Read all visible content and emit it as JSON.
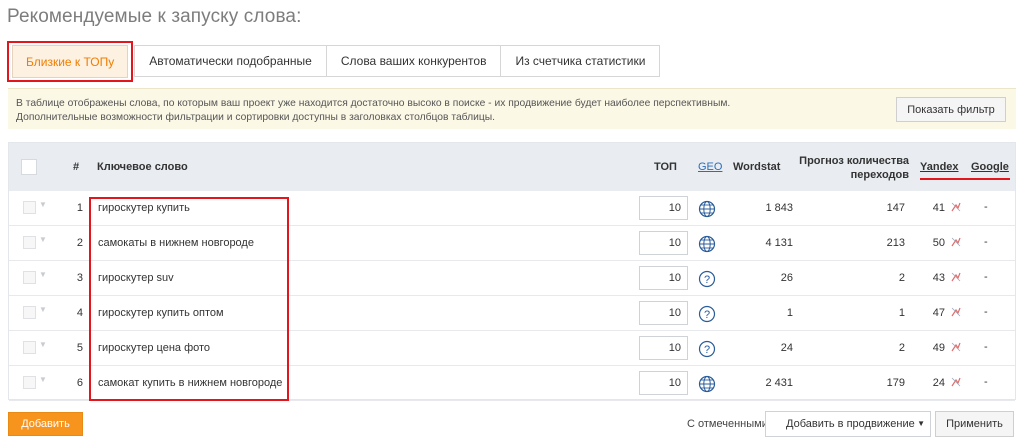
{
  "page": {
    "title": "Рекомендуемые к запуску слова:"
  },
  "tabs": [
    {
      "label": "Близкие к ТОПу",
      "active": true
    },
    {
      "label": "Автоматически подобранные",
      "active": false
    },
    {
      "label": "Слова ваших конкурентов",
      "active": false
    },
    {
      "label": "Из счетчика статистики",
      "active": false
    }
  ],
  "info": {
    "line1": "В таблице отображены слова, по которым ваш проект уже находится достаточно высоко в поиске - их продвижение будет наиболее перспективным.",
    "line2": "Дополнительные возможности фильтрации и сортировки доступны в заголовках столбцов таблицы.",
    "filter_button": "Показать фильтр"
  },
  "table": {
    "headers": {
      "num": "#",
      "keyword": "Ключевое слово",
      "top": "ТОП",
      "geo": "GEO",
      "wordstat": "Wordstat",
      "forecast_line1": "Прогноз количества",
      "forecast_line2": "переходов",
      "yandex": "Yandex",
      "google": "Google"
    },
    "rows": [
      {
        "num": "1",
        "keyword": "гироскутер купить",
        "top": "10",
        "geo": "globe-icon",
        "wordstat": "1 843",
        "forecast": "147",
        "yandex": "41",
        "google": "-"
      },
      {
        "num": "2",
        "keyword": "самокаты в нижнем новгороде",
        "top": "10",
        "geo": "globe-icon",
        "wordstat": "4 131",
        "forecast": "213",
        "yandex": "50",
        "google": "-"
      },
      {
        "num": "3",
        "keyword": "гироскутер suv",
        "top": "10",
        "geo": "question-icon",
        "wordstat": "26",
        "forecast": "2",
        "yandex": "43",
        "google": "-"
      },
      {
        "num": "4",
        "keyword": "гироскутер купить оптом",
        "top": "10",
        "geo": "question-icon",
        "wordstat": "1",
        "forecast": "1",
        "yandex": "47",
        "google": "-"
      },
      {
        "num": "5",
        "keyword": "гироскутер цена фото",
        "top": "10",
        "geo": "question-icon",
        "wordstat": "24",
        "forecast": "2",
        "yandex": "49",
        "google": "-"
      },
      {
        "num": "6",
        "keyword": "самокат купить в нижнем новгороде",
        "top": "10",
        "geo": "globe-icon",
        "wordstat": "2 431",
        "forecast": "179",
        "yandex": "24",
        "google": "-"
      }
    ]
  },
  "footer": {
    "add_button": "Добавить",
    "with_checked_label": "С отмеченными:",
    "action_select": "Добавить в продвижение",
    "apply_button": "Применить"
  },
  "colors": {
    "accent": "#f7941d",
    "annotation": "#e3161d",
    "link": "#2a6ebb"
  }
}
